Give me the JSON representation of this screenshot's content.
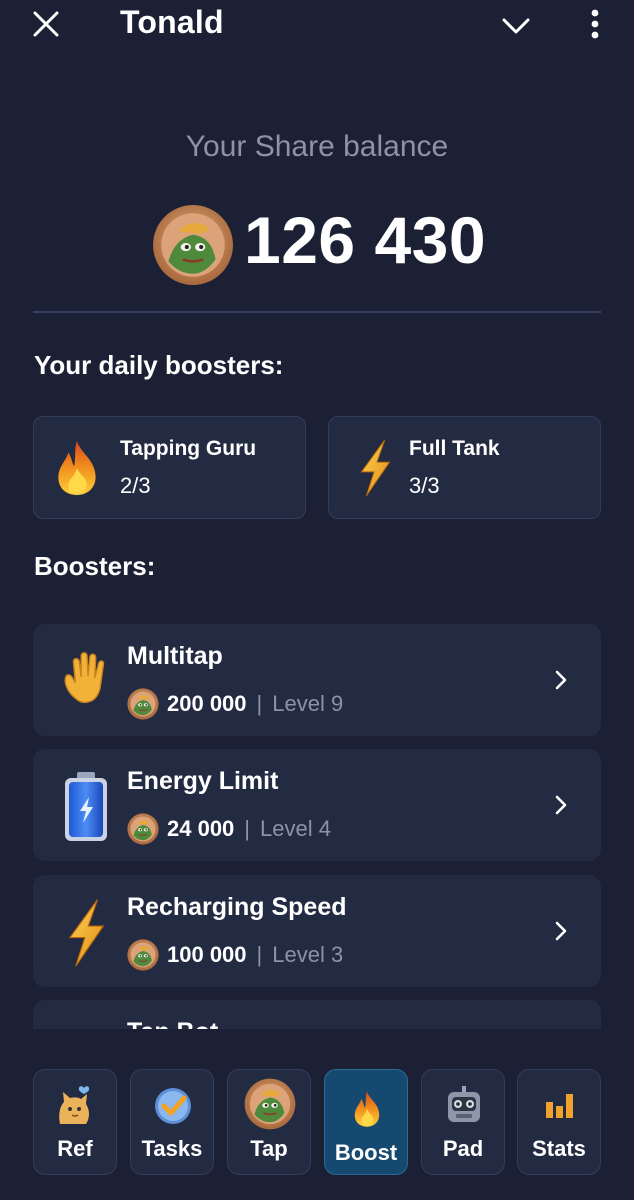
{
  "header": {
    "title": "Tonald"
  },
  "balance": {
    "label": "Your Share balance",
    "value": "126 430"
  },
  "daily": {
    "title": "Your daily boosters:",
    "items": [
      {
        "name": "Tapping Guru",
        "count": "2/3",
        "icon": "fire-icon"
      },
      {
        "name": "Full Tank",
        "count": "3/3",
        "icon": "lightning-icon"
      }
    ]
  },
  "boosters": {
    "title": "Boosters:",
    "items": [
      {
        "name": "Multitap",
        "price": "200 000",
        "separator": "|",
        "level": "Level 9",
        "icon": "waving-hand-icon"
      },
      {
        "name": "Energy Limit",
        "price": "24 000",
        "separator": "|",
        "level": "Level 4",
        "icon": "battery-icon"
      },
      {
        "name": "Recharging Speed",
        "price": "100 000",
        "separator": "|",
        "level": "Level 3",
        "icon": "lightning-icon"
      },
      {
        "name": "Tap Bot",
        "icon": "robot-icon"
      }
    ]
  },
  "nav": {
    "items": [
      {
        "label": "Ref",
        "icon": "cat-icon",
        "active": false
      },
      {
        "label": "Tasks",
        "icon": "check-icon",
        "active": false
      },
      {
        "label": "Tap",
        "icon": "coin-icon",
        "active": false
      },
      {
        "label": "Boost",
        "icon": "fire-icon",
        "active": true
      },
      {
        "label": "Pad",
        "icon": "robot-icon",
        "active": false
      },
      {
        "label": "Stats",
        "icon": "chart-icon",
        "active": false
      }
    ]
  },
  "colors": {
    "background": "#1c2034",
    "card": "#232b42",
    "active_tab": "#15496f",
    "muted_text": "#8e92a6"
  }
}
